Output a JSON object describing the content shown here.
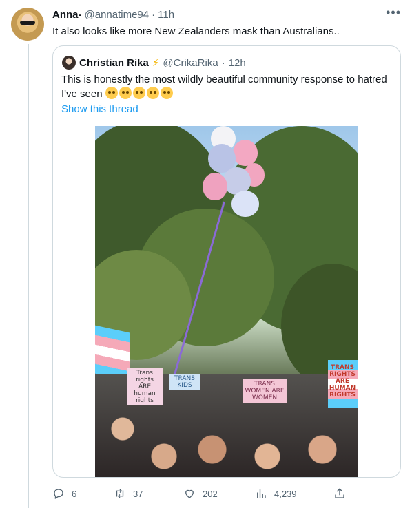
{
  "tweet": {
    "author_name": "Anna-",
    "author_handle": "@annatime94",
    "separator": "·",
    "time": "11h",
    "text": "It also looks like more New Zealanders mask than Australians..",
    "more_icon": "more-icon"
  },
  "quoted": {
    "author_name": "Christian Rika",
    "verified_emoji": "⚡",
    "author_handle": "@CrikaRika",
    "separator": "·",
    "time": "12h",
    "text_line1": "This is honestly the most wildly beautiful community response to hatred",
    "text_line2": "I've seen",
    "emoji_count": 5,
    "show_thread": "Show this thread",
    "photo_signs": [
      "Trans rights ARE human rights",
      "TRANS WOMEN ARE WOMEN",
      "TRANS KIDS",
      "TRANS RIGHTS ARE HUMAN RIGHTS"
    ]
  },
  "actions": {
    "replies": "6",
    "retweets": "37",
    "likes": "202",
    "views": "4,239"
  },
  "colors": {
    "link": "#1d9bf0",
    "muted": "#536471",
    "border": "#cfd9de"
  }
}
